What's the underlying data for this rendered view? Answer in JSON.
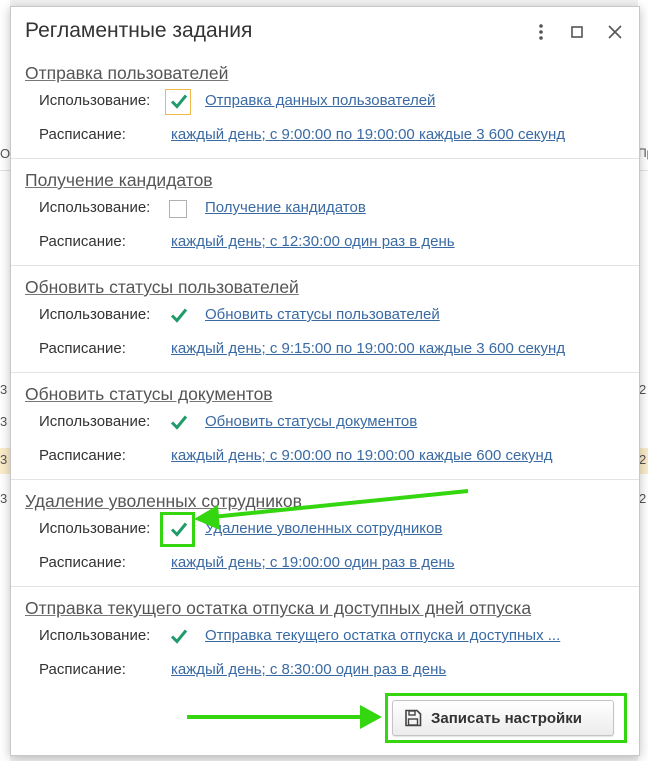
{
  "window": {
    "title": "Регламентные задания",
    "menu_icon": "more-vertical-icon",
    "maximize_icon": "maximize-icon",
    "close_icon": "close-icon"
  },
  "labels": {
    "usage": "Использование:",
    "schedule": "Расписание:"
  },
  "tasks": [
    {
      "title": "Отправка пользователей",
      "checked": true,
      "task_link": "Отправка данных пользователей",
      "schedule": "каждый день; с 9:00:00 по 19:00:00 каждые 3 600 секунд"
    },
    {
      "title": "Получение кандидатов",
      "checked": false,
      "task_link": "Получение кандидатов",
      "schedule": "каждый день; с 12:30:00 один раз в день"
    },
    {
      "title": "Обновить статусы пользователей",
      "checked": true,
      "task_link": "Обновить статусы пользователей",
      "schedule": "каждый день; с 9:15:00 по 19:00:00 каждые 3 600 секунд"
    },
    {
      "title": "Обновить статусы документов",
      "checked": true,
      "task_link": "Обновить статусы документов",
      "schedule": "каждый день; с 9:00:00 по 19:00:00 каждые 600 секунд"
    },
    {
      "title": "Удаление уволенных сотрудников",
      "checked": true,
      "task_link": "Удаление уволенных сотрудников",
      "schedule": "каждый день; с 19:00:00 один раз в день"
    },
    {
      "title": "Отправка текущего остатка отпуска и доступных дней отпуска",
      "checked": true,
      "task_link": "Отправка текущего остатка отпуска и доступных ...",
      "schedule": "каждый день; с 8:30:00 один раз в день"
    }
  ],
  "save_button": {
    "label": "Записать настройки",
    "icon": "floppy-disk-icon"
  },
  "background": {
    "left_chars": [
      "О",
      "3",
      "3",
      "3",
      "3"
    ],
    "right_chars": [
      "Пр",
      "2",
      "2",
      "2"
    ]
  },
  "colors": {
    "link": "#3a6aa3",
    "checkmark": "#1f9c6a",
    "annotation_green": "#33d60f",
    "focus_orange": "#f0b84a"
  }
}
